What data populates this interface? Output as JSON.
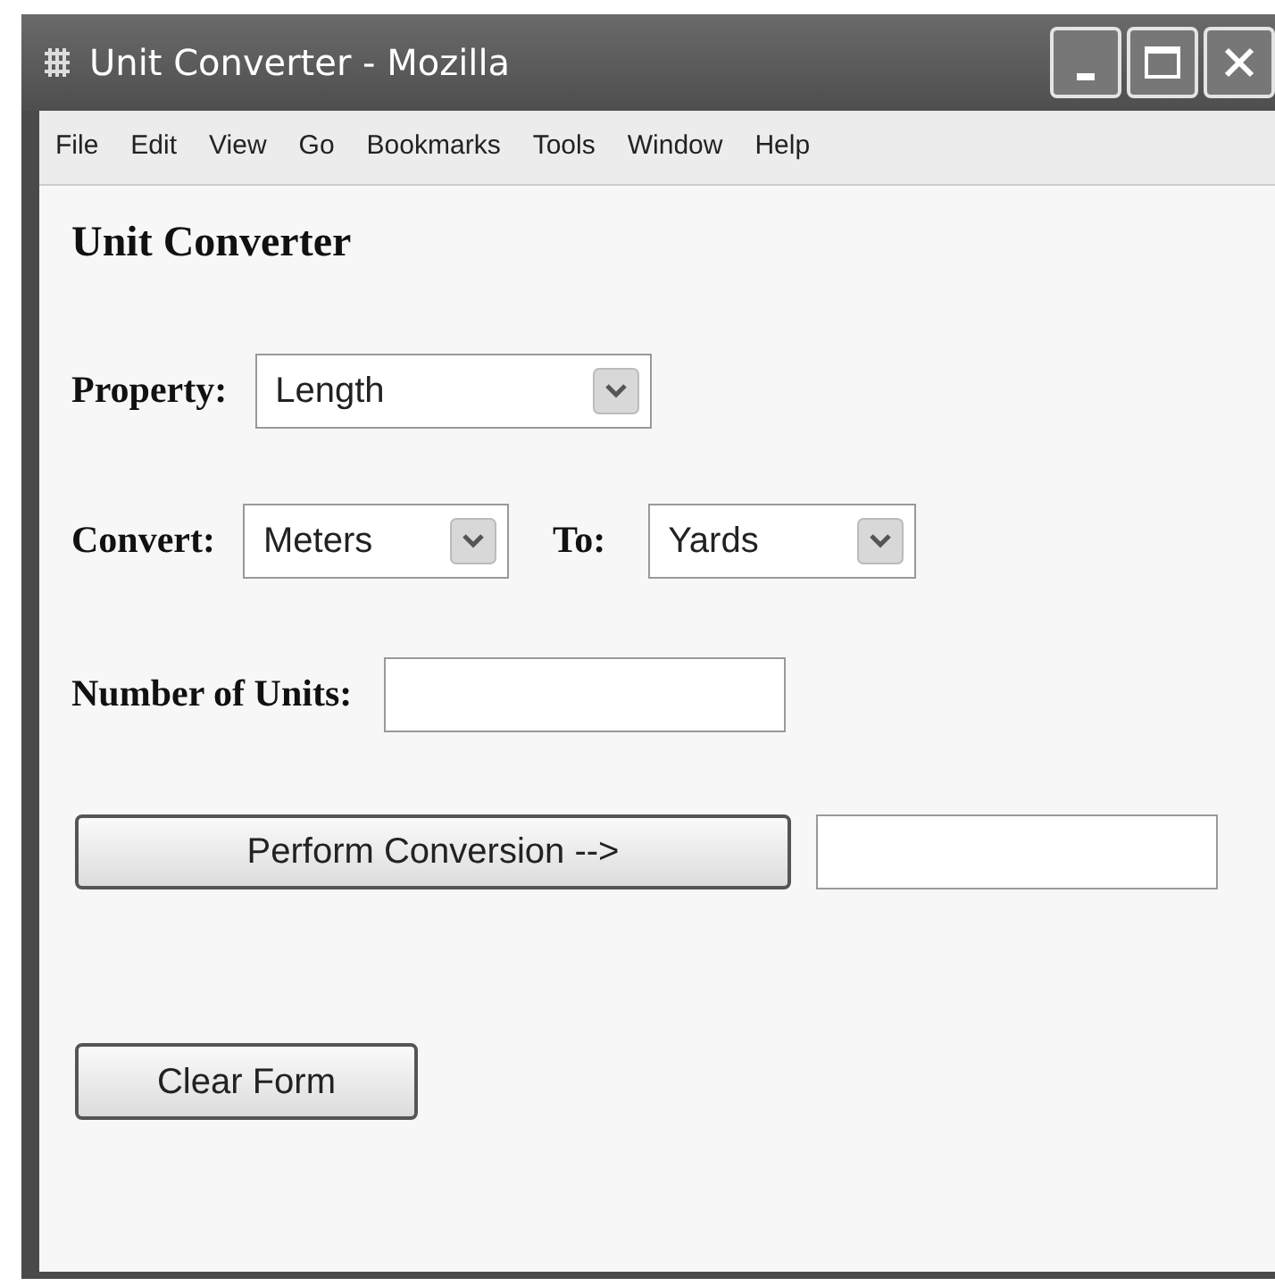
{
  "window": {
    "title": "Unit Converter - Mozilla"
  },
  "menu": [
    "File",
    "Edit",
    "View",
    "Go",
    "Bookmarks",
    "Tools",
    "Window",
    "Help"
  ],
  "page": {
    "heading": "Unit Converter",
    "property": {
      "label": "Property:",
      "value": "Length"
    },
    "convert": {
      "label": "Convert:",
      "value": "Meters"
    },
    "to": {
      "label": "To:",
      "value": "Yards"
    },
    "units": {
      "label": "Number of Units:"
    },
    "convert_button": "Perform Conversion -->",
    "clear_button": "Clear Form"
  }
}
